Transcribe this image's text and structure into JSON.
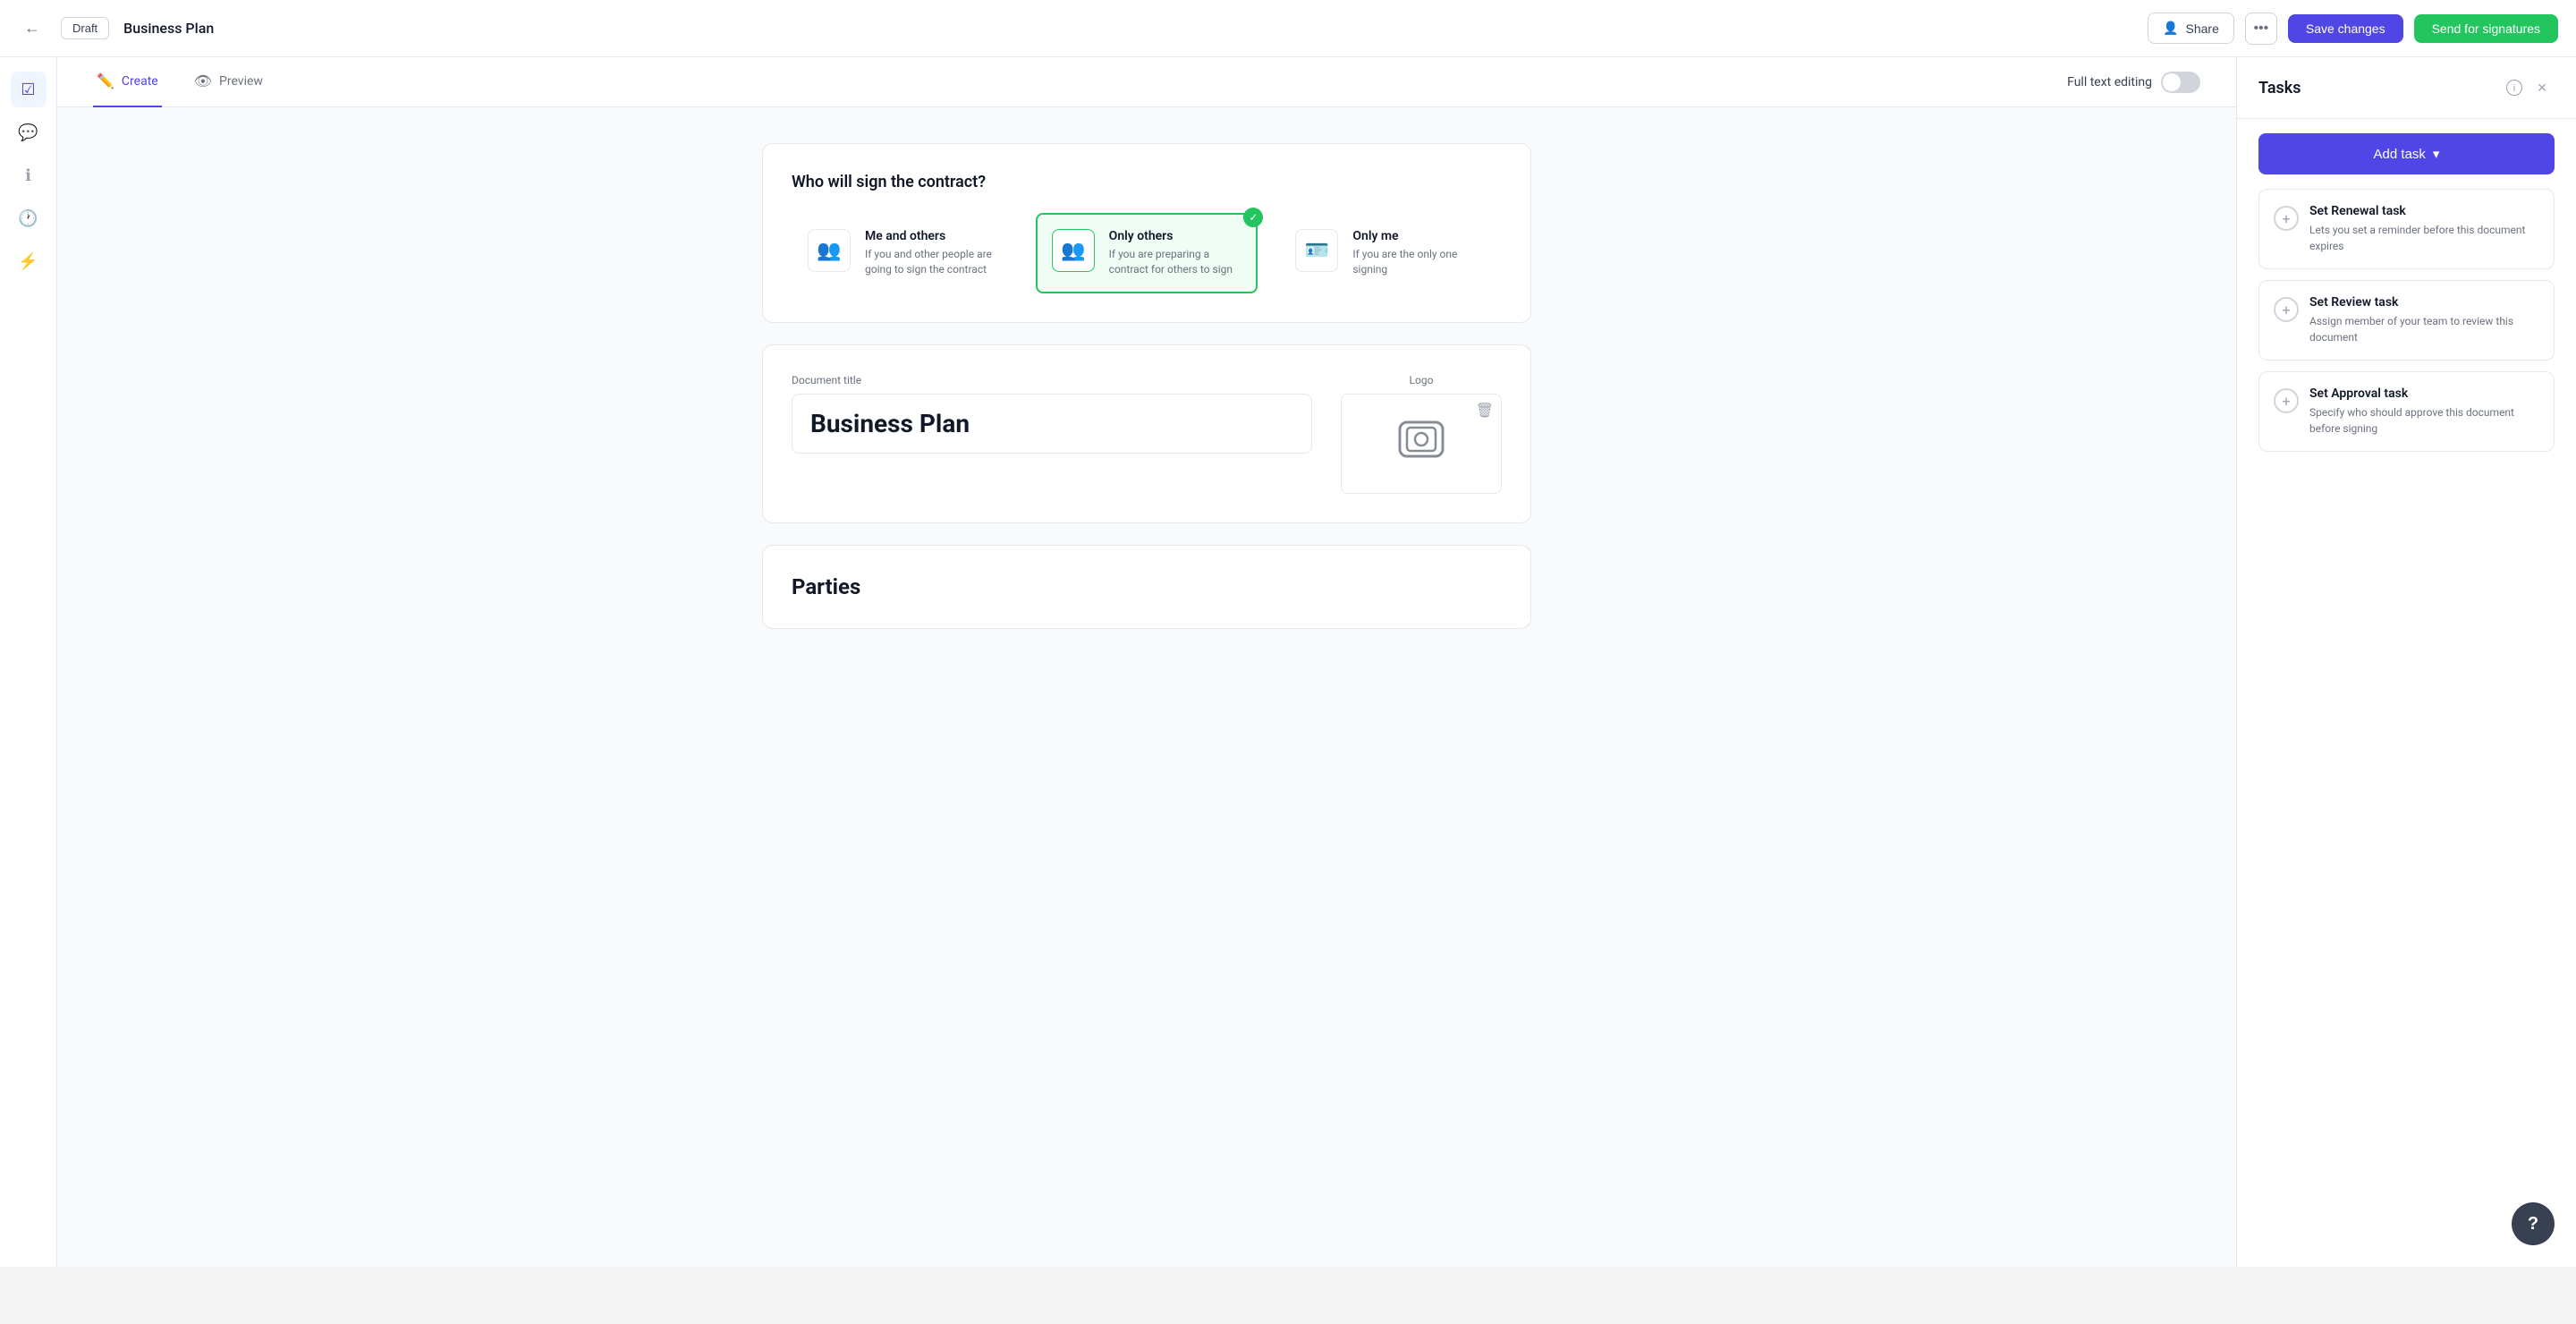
{
  "header": {
    "back_icon": "←",
    "draft_label": "Draft",
    "doc_title": "Business Plan",
    "share_label": "Share",
    "more_icon": "•••",
    "save_label": "Save changes",
    "send_label": "Send for signatures"
  },
  "tabs": {
    "create_label": "Create",
    "preview_label": "Preview",
    "full_text_label": "Full text editing"
  },
  "signers": {
    "title": "Who will sign the contract?",
    "options": [
      {
        "id": "me-and-others",
        "title": "Me and others",
        "desc": "If you and other people are going to sign the contract",
        "selected": false
      },
      {
        "id": "only-others",
        "title": "Only others",
        "desc": "If you are preparing a contract for others to sign",
        "selected": true
      },
      {
        "id": "only-me",
        "title": "Only me",
        "desc": "If you are the only one signing",
        "selected": false
      }
    ]
  },
  "document": {
    "title_label": "Document title",
    "title_value": "Business Plan",
    "logo_label": "Logo"
  },
  "parties": {
    "title": "Parties"
  },
  "sidebar_icons": [
    "✓",
    "💬",
    "ℹ",
    "🕐",
    "⚡"
  ],
  "tasks_panel": {
    "title": "Tasks",
    "add_task_label": "Add task",
    "close_icon": "×",
    "tasks": [
      {
        "name": "Set Renewal task",
        "desc": "Lets you set a reminder before this document expires"
      },
      {
        "name": "Set Review task",
        "desc": "Assign member of your team to review this document"
      },
      {
        "name": "Set Approval task",
        "desc": "Specify who should approve this document before signing"
      }
    ]
  },
  "help": {
    "label": "?"
  }
}
